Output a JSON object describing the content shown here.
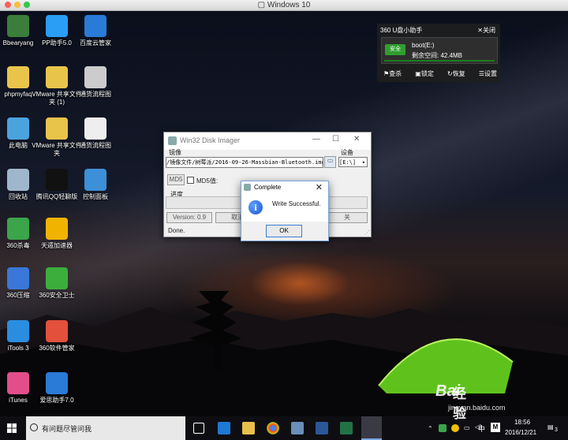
{
  "window_title": "Windows 10",
  "desktop_icons": [
    {
      "label": "Bbearyang",
      "color": "#3b7d3b"
    },
    {
      "label": "PP助手5.0",
      "color": "#2a9df4"
    },
    {
      "label": "百度云管家",
      "color": "#2a7ad8"
    },
    {
      "label": "phpmyfaq",
      "color": "#e9c44a"
    },
    {
      "label": "VMware 共享文件夹 (1)",
      "color": "#e9c44a"
    },
    {
      "label": "通货流程图",
      "color": "#cccccc"
    },
    {
      "label": "此电脑",
      "color": "#4aa3df"
    },
    {
      "label": "VMware 共享文件夹",
      "color": "#e9c44a"
    },
    {
      "label": "通货流程图",
      "color": "#eeeeee"
    },
    {
      "label": "回收站",
      "color": "#9fb7cc"
    },
    {
      "label": "腾讯QQ轻聊版",
      "color": "#111111"
    },
    {
      "label": "控制面板",
      "color": "#3d8fd8"
    },
    {
      "label": "360杀毒",
      "color": "#3aa54a"
    },
    {
      "label": "天遁加速器",
      "color": "#f0b400"
    },
    {
      "label": "360压缩",
      "color": "#3b77d8"
    },
    {
      "label": "360安全卫士",
      "color": "#3cae3c"
    },
    {
      "label": "iTools 3",
      "color": "#2a8de0"
    },
    {
      "label": "360软件管家",
      "color": "#e3503c"
    },
    {
      "label": "iTunes",
      "color": "#e34e8a"
    },
    {
      "label": "爱思助手7.0",
      "color": "#2a7ad8"
    }
  ],
  "widget": {
    "title": "360 U盘小助手",
    "close": "✕关闭",
    "badge": "安全",
    "drive": "boot(E:)",
    "free": "剩余空间: 42.4MB",
    "buttons": [
      "查杀",
      "锁定",
      "恢复",
      "设置"
    ]
  },
  "app": {
    "title": "Win32 Disk Imager",
    "image_label": "镜像",
    "device_label": "设备",
    "image_path": "/镜像文件/树莓派/2016-09-26-Massbian-Bluetooth.img",
    "device_value": "[E:\\]",
    "md5_button": "MD5",
    "md5_label": "MD5值:",
    "progress_label": "进度",
    "version": "Version: 0.9",
    "cancel_button": "取消",
    "exit_button": "关",
    "status": "Done."
  },
  "dialog": {
    "title": "Complete",
    "close": "✕",
    "message": "Write Successful.",
    "ok_button": "OK"
  },
  "taskbar": {
    "search_placeholder": "有问题尽管问我",
    "ime_lang": "中",
    "ime_mode": "M",
    "time": "18:56",
    "date": "2016/12/21",
    "notification_count": "3"
  },
  "watermark": {
    "brand": "Bai",
    "brand_cn": "经验",
    "url": "jingyan.baidu.com"
  }
}
